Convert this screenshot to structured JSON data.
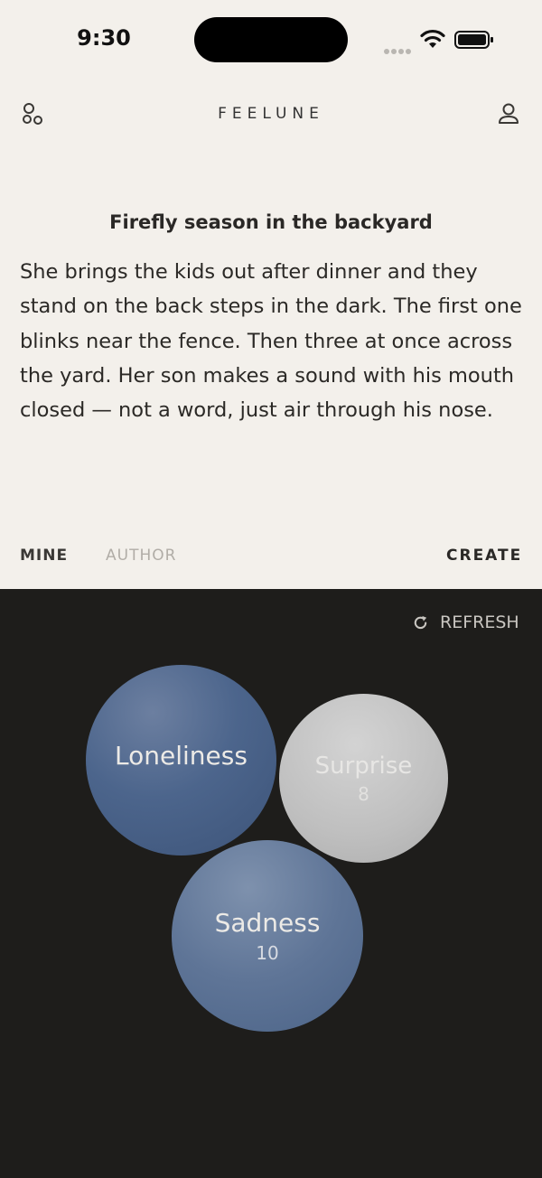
{
  "status": {
    "time": "9:30"
  },
  "header": {
    "brand": "FEELUNE",
    "left_icon": "circles-icon",
    "right_icon": "profile-icon"
  },
  "story": {
    "title": "Firefly season in the backyard",
    "body": "She brings the kids out after dinner and they stand on the back steps in the dark. The first one blinks near the fence. Then three at once across the yard. Her son makes a sound with his mouth closed — not a word, just air through his nose."
  },
  "tabs": {
    "mine": "MINE",
    "author": "AUTHOR",
    "create": "CREATE"
  },
  "refresh": {
    "label": "REFRESH",
    "icon": "refresh-icon"
  },
  "bubbles": [
    {
      "name": "Loneliness",
      "count": "",
      "color": "#4c658c"
    },
    {
      "name": "Surprise",
      "count": "8",
      "color": "#bfbfbf"
    },
    {
      "name": "Sadness",
      "count": "10",
      "color": "#5f7597"
    }
  ],
  "colors": {
    "top_background": "#f3f0eb",
    "bottom_background": "#1e1d1b"
  }
}
